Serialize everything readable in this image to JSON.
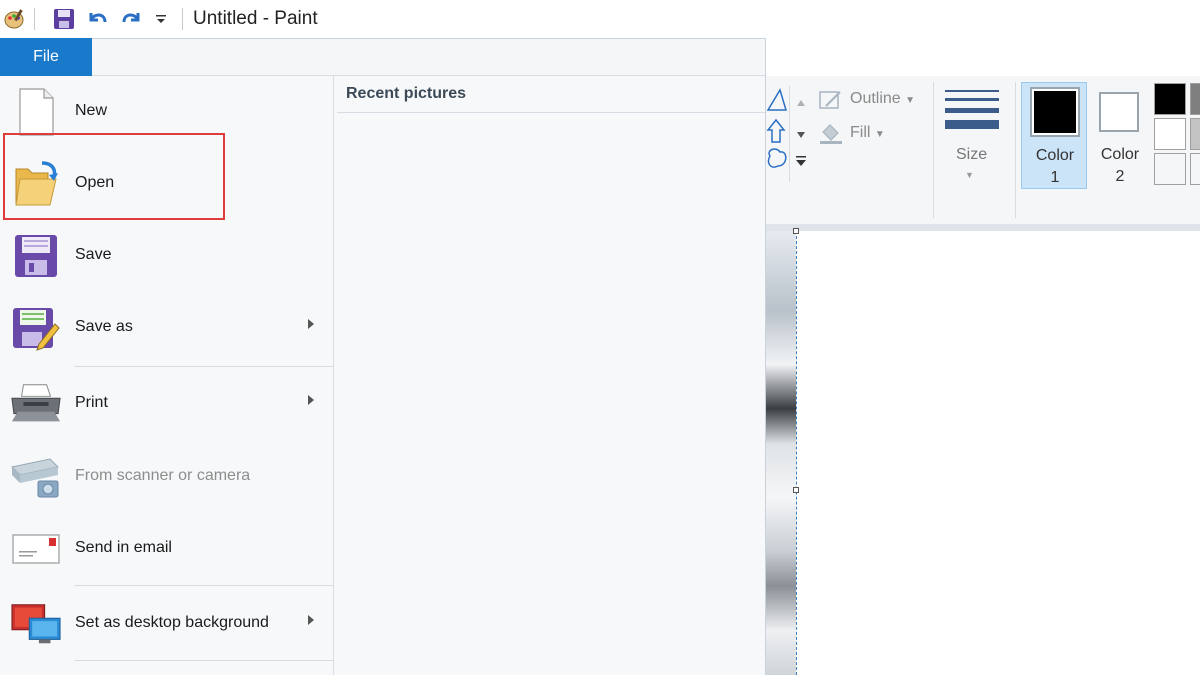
{
  "window": {
    "title": "Untitled - Paint"
  },
  "quick_access": {
    "app_icon": "paint-palette-icon",
    "save_icon": "floppy-disk-icon",
    "undo_icon": "undo-arrow-icon",
    "redo_icon": "redo-arrow-icon",
    "customize_icon": "qat-dropdown-icon"
  },
  "file_tab": {
    "label": "File"
  },
  "file_menu": {
    "items": [
      {
        "label": "New",
        "icon": "blank-page-icon",
        "has_submenu": false,
        "enabled": true
      },
      {
        "label": "Open",
        "icon": "open-folder-icon",
        "has_submenu": false,
        "enabled": true
      },
      {
        "label": "Save",
        "icon": "floppy-disk-icon",
        "has_submenu": false,
        "enabled": true,
        "highlighted": true
      },
      {
        "label": "Save as",
        "icon": "save-as-icon",
        "has_submenu": true,
        "enabled": true
      },
      {
        "label": "Print",
        "icon": "printer-icon",
        "has_submenu": true,
        "enabled": true
      },
      {
        "label": "From scanner or camera",
        "icon": "scanner-camera-icon",
        "has_submenu": false,
        "enabled": false
      },
      {
        "label": "Send in email",
        "icon": "email-envelope-icon",
        "has_submenu": false,
        "enabled": true
      },
      {
        "label": "Set as desktop background",
        "icon": "desktop-monitor-icon",
        "has_submenu": true,
        "enabled": true
      }
    ],
    "recent_title": "Recent pictures"
  },
  "ribbon": {
    "outline_label": "Outline",
    "fill_label": "Fill",
    "size_label": "Size",
    "color1_label": "Color",
    "color1_num": "1",
    "color2_label": "Color",
    "color2_num": "2",
    "colors": {
      "color1": "#000000",
      "color2": "#ffffff",
      "accent": "#1979ca",
      "highlight": "#e03b3b"
    }
  }
}
